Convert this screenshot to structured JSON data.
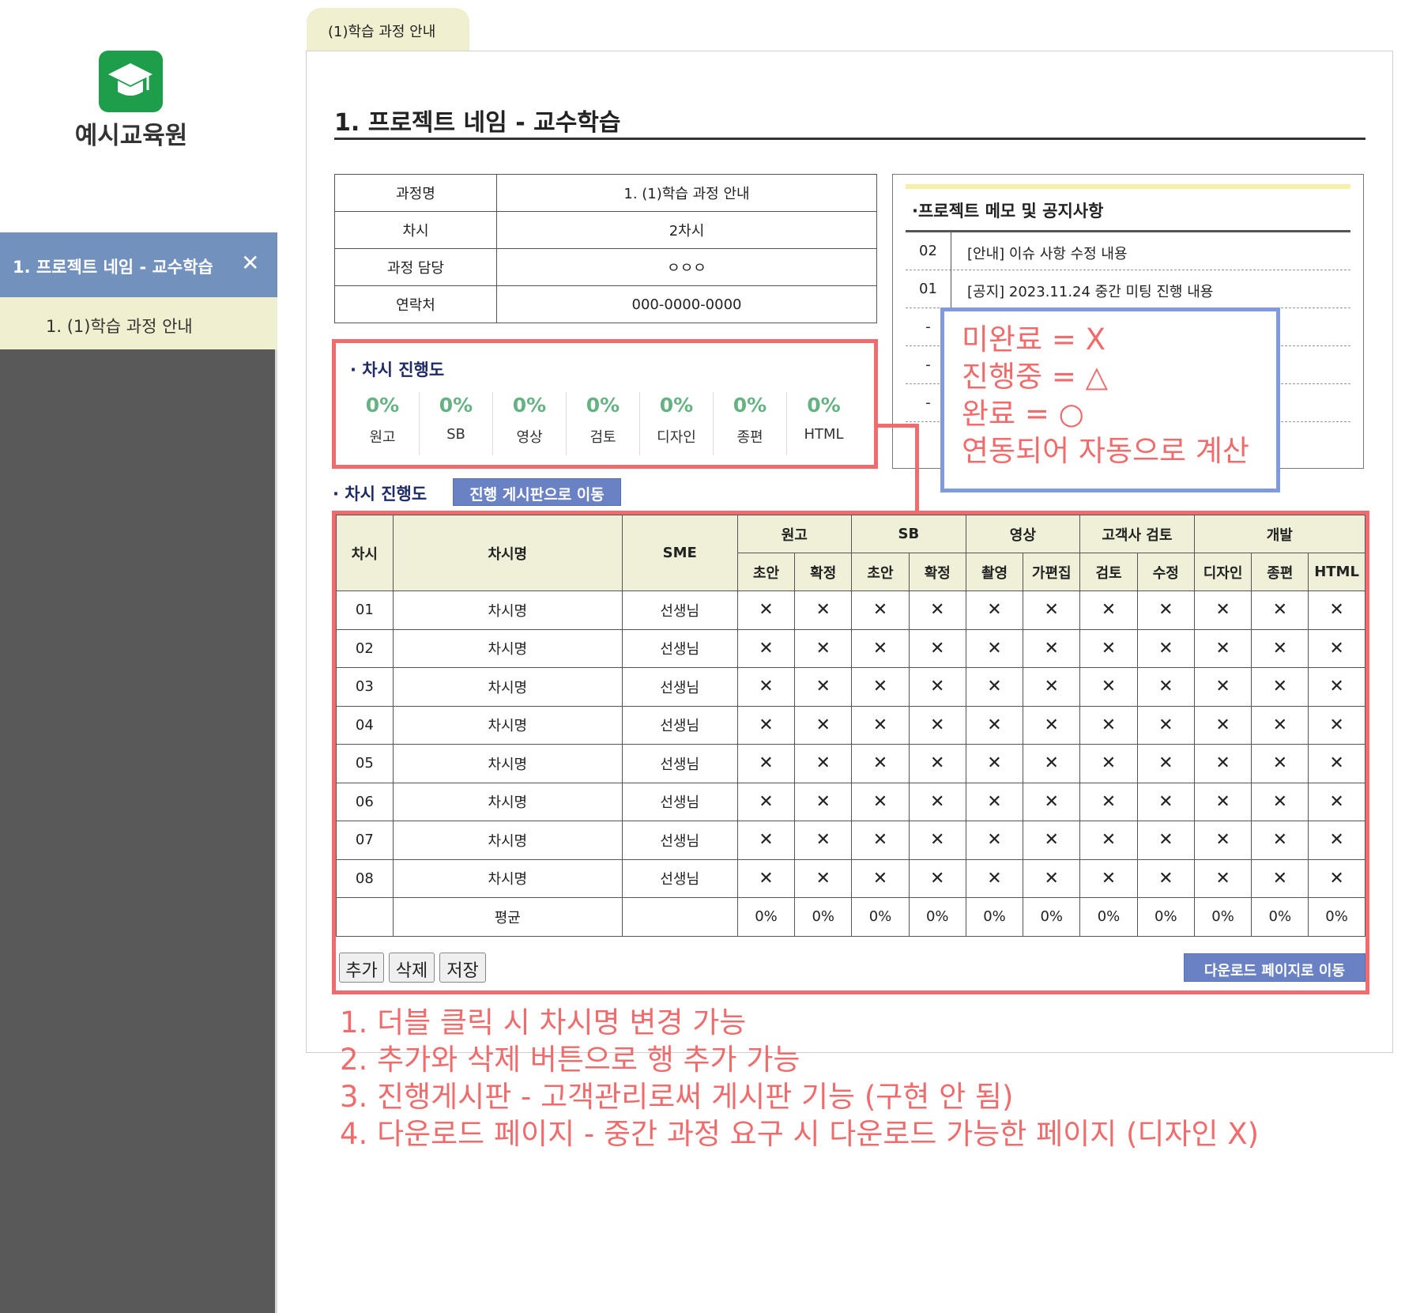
{
  "sidebar": {
    "logo_text": "예시교육원",
    "active_item": "1. 프로젝트 네임 - 교수학습",
    "close_glyph": "✕",
    "sub_item": "1. (1)학습 과정 안내"
  },
  "tab": {
    "label": "(1)학습 과정 안내"
  },
  "page": {
    "title": "1. 프로젝트 네임 - 교수학습"
  },
  "info": [
    {
      "label": "과정명",
      "value": "1. (1)학습 과정 안내"
    },
    {
      "label": "차시",
      "value": "2차시"
    },
    {
      "label": "과정 담당",
      "value": "ㅇㅇㅇ"
    },
    {
      "label": "연락처",
      "value": "000-0000-0000"
    }
  ],
  "notice": {
    "title": "·프로젝트 메모 및 공지사항",
    "rows": [
      {
        "num": "02",
        "text": "[안내] 이슈 사항 수정 내용"
      },
      {
        "num": "01",
        "text": "[공지] 2023.11.24 중간 미팅 진행 내용"
      },
      {
        "num": "-",
        "text": ""
      },
      {
        "num": "-",
        "text": ""
      },
      {
        "num": "-",
        "text": ""
      }
    ]
  },
  "progress": {
    "title": "· 차시 진행도",
    "items": [
      {
        "value": "0%",
        "label": "원고"
      },
      {
        "value": "0%",
        "label": "SB"
      },
      {
        "value": "0%",
        "label": "영상"
      },
      {
        "value": "0%",
        "label": "검토"
      },
      {
        "value": "0%",
        "label": "디자인"
      },
      {
        "value": "0%",
        "label": "종편"
      },
      {
        "value": "0%",
        "label": "HTML"
      }
    ]
  },
  "legend": {
    "line1": "미완료 = X",
    "line2": "진행중 = △",
    "line3": "완료 = ○",
    "line4": "연동되어 자동으로 계산"
  },
  "section2": {
    "title": "· 차시 진행도",
    "board_button": "진행 게시판으로 이동"
  },
  "table": {
    "headers": {
      "chasi": "차시",
      "name": "차시명",
      "sme": "SME",
      "groups": [
        "원고",
        "SB",
        "영상",
        "고객사 검토",
        "개발"
      ],
      "subs": [
        "초안",
        "확정",
        "초안",
        "확정",
        "촬영",
        "가편집",
        "검토",
        "수정",
        "디자인",
        "종편",
        "HTML"
      ]
    },
    "rows": [
      {
        "num": "01",
        "name": "차시명",
        "sme": "선생님"
      },
      {
        "num": "02",
        "name": "차시명",
        "sme": "선생님"
      },
      {
        "num": "03",
        "name": "차시명",
        "sme": "선생님"
      },
      {
        "num": "04",
        "name": "차시명",
        "sme": "선생님"
      },
      {
        "num": "05",
        "name": "차시명",
        "sme": "선생님"
      },
      {
        "num": "06",
        "name": "차시명",
        "sme": "선생님"
      },
      {
        "num": "07",
        "name": "차시명",
        "sme": "선생님"
      },
      {
        "num": "08",
        "name": "차시명",
        "sme": "선생님"
      }
    ],
    "status_glyph": "✕",
    "avg_label": "평균",
    "avg_values": [
      "0%",
      "0%",
      "0%",
      "0%",
      "0%",
      "0%",
      "0%",
      "0%",
      "0%",
      "0%",
      "0%"
    ]
  },
  "buttons": {
    "add": "추가",
    "delete": "삭제",
    "save": "저장",
    "download": "다운로드 페이지로 이동"
  },
  "notes": [
    "1. 더블 클릭 시 차시명 변경 가능",
    "2. 추가와 삭제 버튼으로 행 추가 가능",
    "3. 진행게시판 - 고객관리로써 게시판 기능 (구현 안 됨)",
    "4. 다운로드 페이지 - 중간 과정 요구 시 다운로드 가능한 페이지 (디자인 X)"
  ],
  "colors": {
    "sidebar_bg": "#595959",
    "active_item_bg": "#7391bd",
    "sub_item_bg": "#f0efcf",
    "annotation_red": "#f06b6b",
    "annotation_blue": "#7f9bdd",
    "button_blue": "#6a82c4",
    "progress_green": "#65b283",
    "logo_green": "#1e9e4a"
  },
  "icons": {
    "logo": "graduation-cap-icon"
  }
}
